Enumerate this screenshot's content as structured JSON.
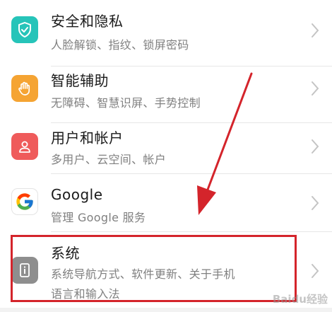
{
  "items": [
    {
      "title": "安全和隐私",
      "subtitle": "人脸解锁、指纹、锁屏密码",
      "icon": "shield-icon",
      "color": "#26c4b9"
    },
    {
      "title": "智能辅助",
      "subtitle": "无障碍、智慧识屏、手势控制",
      "icon": "hand-icon",
      "color": "#f5a433"
    },
    {
      "title": "用户和帐户",
      "subtitle": "多用户、云空间、帐户",
      "icon": "user-icon",
      "color": "#ef5b5b"
    },
    {
      "title": "Google",
      "subtitle": "管理 Google 服务",
      "icon": "google-icon",
      "color": "#ffffff"
    },
    {
      "title": "系统",
      "subtitle": "系统导航方式、软件更新、关于手机",
      "subtitle2": "语言和输入法",
      "icon": "system-info-icon",
      "color": "#8e8e8e"
    }
  ],
  "annotation": {
    "color": "#d4242b"
  },
  "watermark": "Baidu经验"
}
